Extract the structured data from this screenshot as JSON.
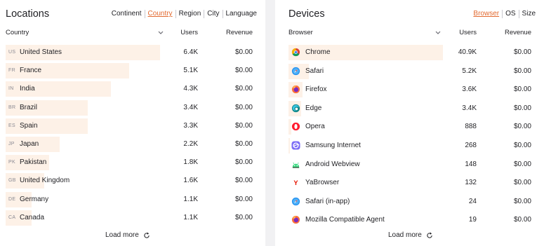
{
  "locations": {
    "title": "Locations",
    "tabs": [
      "Continent",
      "Country",
      "Region",
      "City",
      "Language"
    ],
    "active_tab": "Country",
    "col_dimension": "Country",
    "col_users": "Users",
    "col_revenue": "Revenue",
    "rows": [
      {
        "code": "US",
        "name": "United States",
        "users": "6.4K",
        "revenue": "$0.00",
        "share": 1.0
      },
      {
        "code": "FR",
        "name": "France",
        "users": "5.1K",
        "revenue": "$0.00",
        "share": 0.8
      },
      {
        "code": "IN",
        "name": "India",
        "users": "4.3K",
        "revenue": "$0.00",
        "share": 0.68
      },
      {
        "code": "BR",
        "name": "Brazil",
        "users": "3.4K",
        "revenue": "$0.00",
        "share": 0.53
      },
      {
        "code": "ES",
        "name": "Spain",
        "users": "3.3K",
        "revenue": "$0.00",
        "share": 0.53
      },
      {
        "code": "JP",
        "name": "Japan",
        "users": "2.2K",
        "revenue": "$0.00",
        "share": 0.35
      },
      {
        "code": "PK",
        "name": "Pakistan",
        "users": "1.8K",
        "revenue": "$0.00",
        "share": 0.28
      },
      {
        "code": "GB",
        "name": "United Kingdom",
        "users": "1.6K",
        "revenue": "$0.00",
        "share": 0.25
      },
      {
        "code": "DE",
        "name": "Germany",
        "users": "1.1K",
        "revenue": "$0.00",
        "share": 0.17
      },
      {
        "code": "CA",
        "name": "Canada",
        "users": "1.1K",
        "revenue": "$0.00",
        "share": 0.17
      }
    ],
    "load_more": "Load more"
  },
  "devices": {
    "title": "Devices",
    "tabs": [
      "Browser",
      "OS",
      "Size"
    ],
    "active_tab": "Browser",
    "col_dimension": "Browser",
    "col_users": "Users",
    "col_revenue": "Revenue",
    "rows": [
      {
        "icon": "chrome-icon",
        "name": "Chrome",
        "users": "40.9K",
        "revenue": "$0.00",
        "share": 1.0
      },
      {
        "icon": "safari-icon",
        "name": "Safari",
        "users": "5.2K",
        "revenue": "$0.00",
        "share": 0.13
      },
      {
        "icon": "firefox-icon",
        "name": "Firefox",
        "users": "3.6K",
        "revenue": "$0.00",
        "share": 0.09
      },
      {
        "icon": "edge-icon",
        "name": "Edge",
        "users": "3.4K",
        "revenue": "$0.00",
        "share": 0.08
      },
      {
        "icon": "opera-icon",
        "name": "Opera",
        "users": "888",
        "revenue": "$0.00",
        "share": 0.02
      },
      {
        "icon": "samsung-internet-icon",
        "name": "Samsung Internet",
        "users": "268",
        "revenue": "$0.00",
        "share": 0.01
      },
      {
        "icon": "android-webview-icon",
        "name": "Android Webview",
        "users": "148",
        "revenue": "$0.00",
        "share": 0.0
      },
      {
        "icon": "yabrowser-icon",
        "name": "YaBrowser",
        "users": "132",
        "revenue": "$0.00",
        "share": 0.0
      },
      {
        "icon": "safari-icon",
        "name": "Safari (in-app)",
        "users": "24",
        "revenue": "$0.00",
        "share": 0.0
      },
      {
        "icon": "mozilla-icon",
        "name": "Mozilla Compatible Agent",
        "users": "19",
        "revenue": "$0.00",
        "share": 0.0
      }
    ],
    "load_more": "Load more"
  },
  "colors": {
    "accent": "#e2692f",
    "bar_fill": "#fdf1e7"
  }
}
